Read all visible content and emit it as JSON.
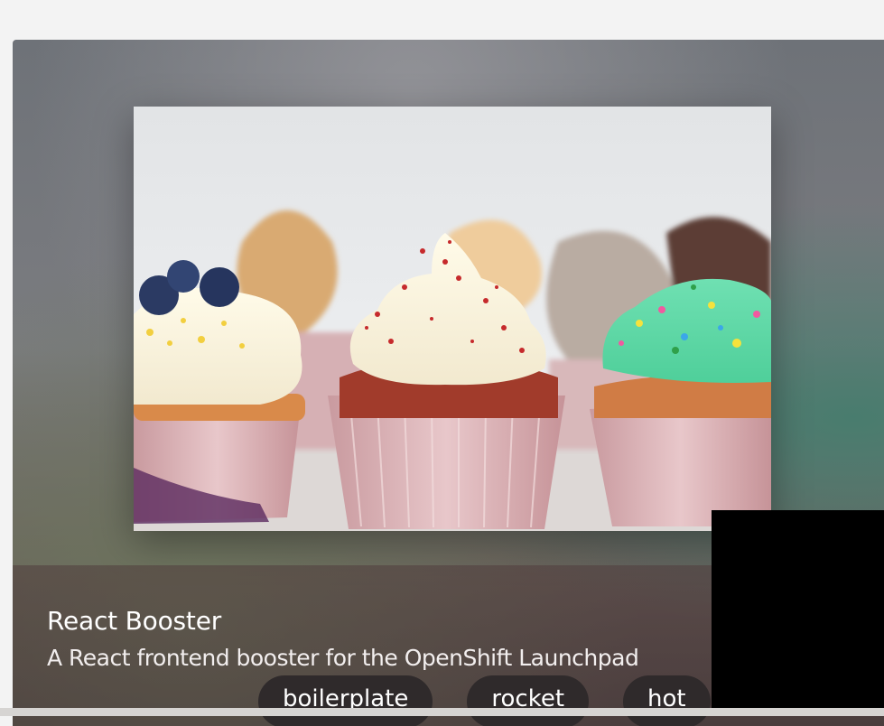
{
  "card": {
    "title": "React Booster",
    "description": "A React frontend booster for the OpenShift Launchpad",
    "tags": [
      "boilerplate",
      "rocket",
      "hot"
    ]
  },
  "image": {
    "subject": "cupcakes-photo"
  }
}
